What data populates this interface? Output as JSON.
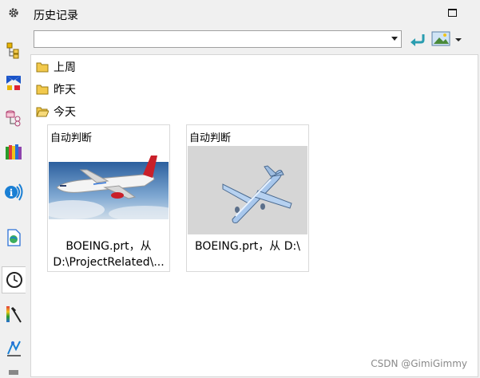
{
  "panel": {
    "title": "历史记录",
    "combo_value": ""
  },
  "groups": [
    {
      "label": "上周",
      "icon": "folder-closed-icon"
    },
    {
      "label": "昨天",
      "icon": "folder-closed-icon"
    },
    {
      "label": "今天",
      "icon": "folder-open-icon"
    }
  ],
  "cards": [
    {
      "label": "自动判断",
      "caption_line1": "BOEING.prt，从",
      "caption_line2": "D:\\ProjectRelated\\...",
      "thumb": "airliner-photo"
    },
    {
      "label": "自动判断",
      "caption_line1": "BOEING.prt，从 D:\\",
      "caption_line2": "",
      "thumb": "airplane-model-render"
    }
  ],
  "toolbar_icons": [
    "settings-gear-icon",
    "assembly-navigator-icon",
    "constraint-navigator-icon",
    "part-navigator-icon",
    "reuse-library-icon",
    "hd3d-tools-icon",
    "web-browser-icon",
    "history-clock-icon",
    "system-materials-icon",
    "process-studio-icon"
  ],
  "watermark": "CSDN @GimiGimmy",
  "colors": {
    "accent_blue": "#1a7fd4",
    "folder_yellow": "#f2c94c"
  }
}
